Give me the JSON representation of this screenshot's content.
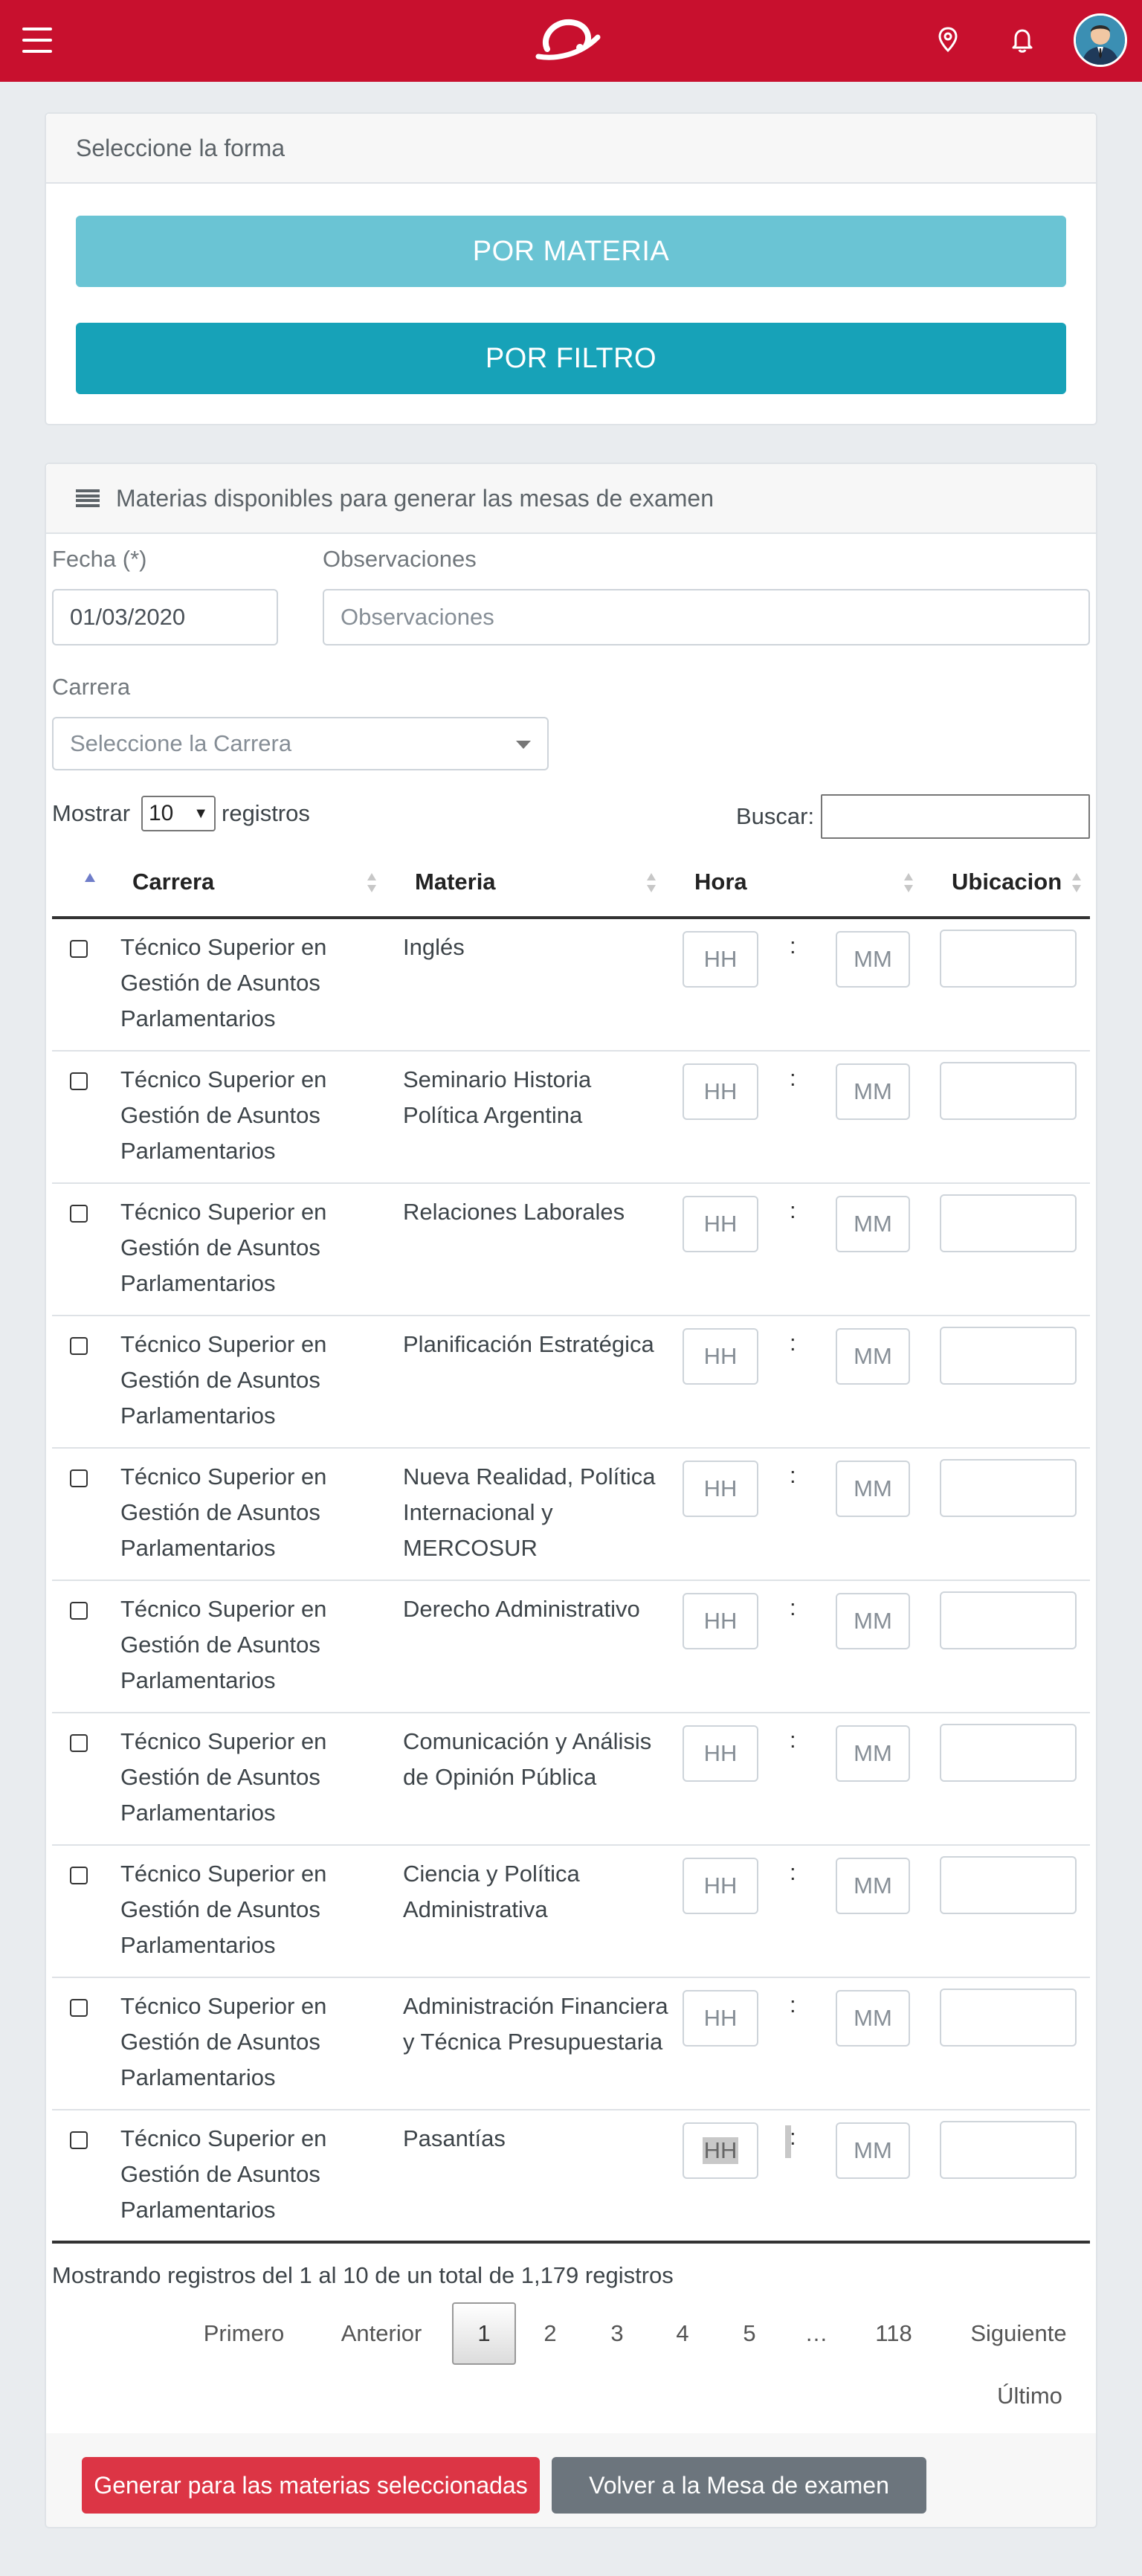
{
  "header": {
    "menu_icon": "hamburger-menu-icon",
    "logo_icon": "brand-logo-icon",
    "location_icon": "location-pin-icon",
    "notification_icon": "bell-icon",
    "avatar_icon": "user-avatar-icon"
  },
  "colors": {
    "brand": "#c8102e",
    "info_light": "#6ac4d4",
    "info": "#17a2b8",
    "danger": "#dc3545",
    "secondary": "#6c757d"
  },
  "form_card": {
    "title": "Seleccione la forma",
    "btn_por_materia": "POR MATERIA",
    "btn_por_filtro": "POR FILTRO"
  },
  "materias_card": {
    "title": "Materias disponibles para generar las mesas de examen",
    "fecha_label": "Fecha (*)",
    "fecha_value": "01/03/2020",
    "observaciones_label": "Observaciones",
    "observaciones_placeholder": "Observaciones",
    "carrera_label": "Carrera",
    "carrera_placeholder": "Seleccione la Carrera",
    "mostrar_label": "Mostrar",
    "mostrar_value": "10",
    "registros_label": "registros",
    "buscar_label": "Buscar:",
    "buscar_value": ""
  },
  "table": {
    "columns": [
      "Carrera",
      "Materia",
      "Hora",
      "Ubicacion"
    ],
    "hh_placeholder": "HH",
    "mm_placeholder": "MM",
    "colon": ":",
    "rows": [
      {
        "carrera": "Técnico Superior en Gestión de Asuntos Parlamentarios",
        "materia": "Inglés"
      },
      {
        "carrera": "Técnico Superior en Gestión de Asuntos Parlamentarios",
        "materia": "Seminario Historia Política Argentina"
      },
      {
        "carrera": "Técnico Superior en Gestión de Asuntos Parlamentarios",
        "materia": "Relaciones Laborales"
      },
      {
        "carrera": "Técnico Superior en Gestión de Asuntos Parlamentarios",
        "materia": "Planificación Estratégica"
      },
      {
        "carrera": "Técnico Superior en Gestión de Asuntos Parlamentarios",
        "materia": "Nueva Realidad, Política Internacional y MERCOSUR"
      },
      {
        "carrera": "Técnico Superior en Gestión de Asuntos Parlamentarios",
        "materia": "Derecho Administrativo"
      },
      {
        "carrera": "Técnico Superior en Gestión de Asuntos Parlamentarios",
        "materia": "Comunicación y Análisis de Opinión Pública"
      },
      {
        "carrera": "Técnico Superior en Gestión de Asuntos Parlamentarios",
        "materia": "Ciencia y Política Administrativa"
      },
      {
        "carrera": "Técnico Superior en Gestión de Asuntos Parlamentarios",
        "materia": "Administración Financiera y Técnica Presupuestaria"
      },
      {
        "carrera": "Técnico Superior en Gestión de Asuntos Parlamentarios",
        "materia": "Pasantías"
      }
    ]
  },
  "pagination": {
    "info": "Mostrando registros del 1 al 10 de un total de 1,179 registros",
    "first": "Primero",
    "prev": "Anterior",
    "pages": [
      "1",
      "2",
      "3",
      "4",
      "5",
      "…",
      "118"
    ],
    "next": "Siguiente",
    "last": "Último",
    "current_page": "1"
  },
  "actions": {
    "generate": "Generar para las materias seleccionadas",
    "back": "Volver a la Mesa de examen"
  }
}
